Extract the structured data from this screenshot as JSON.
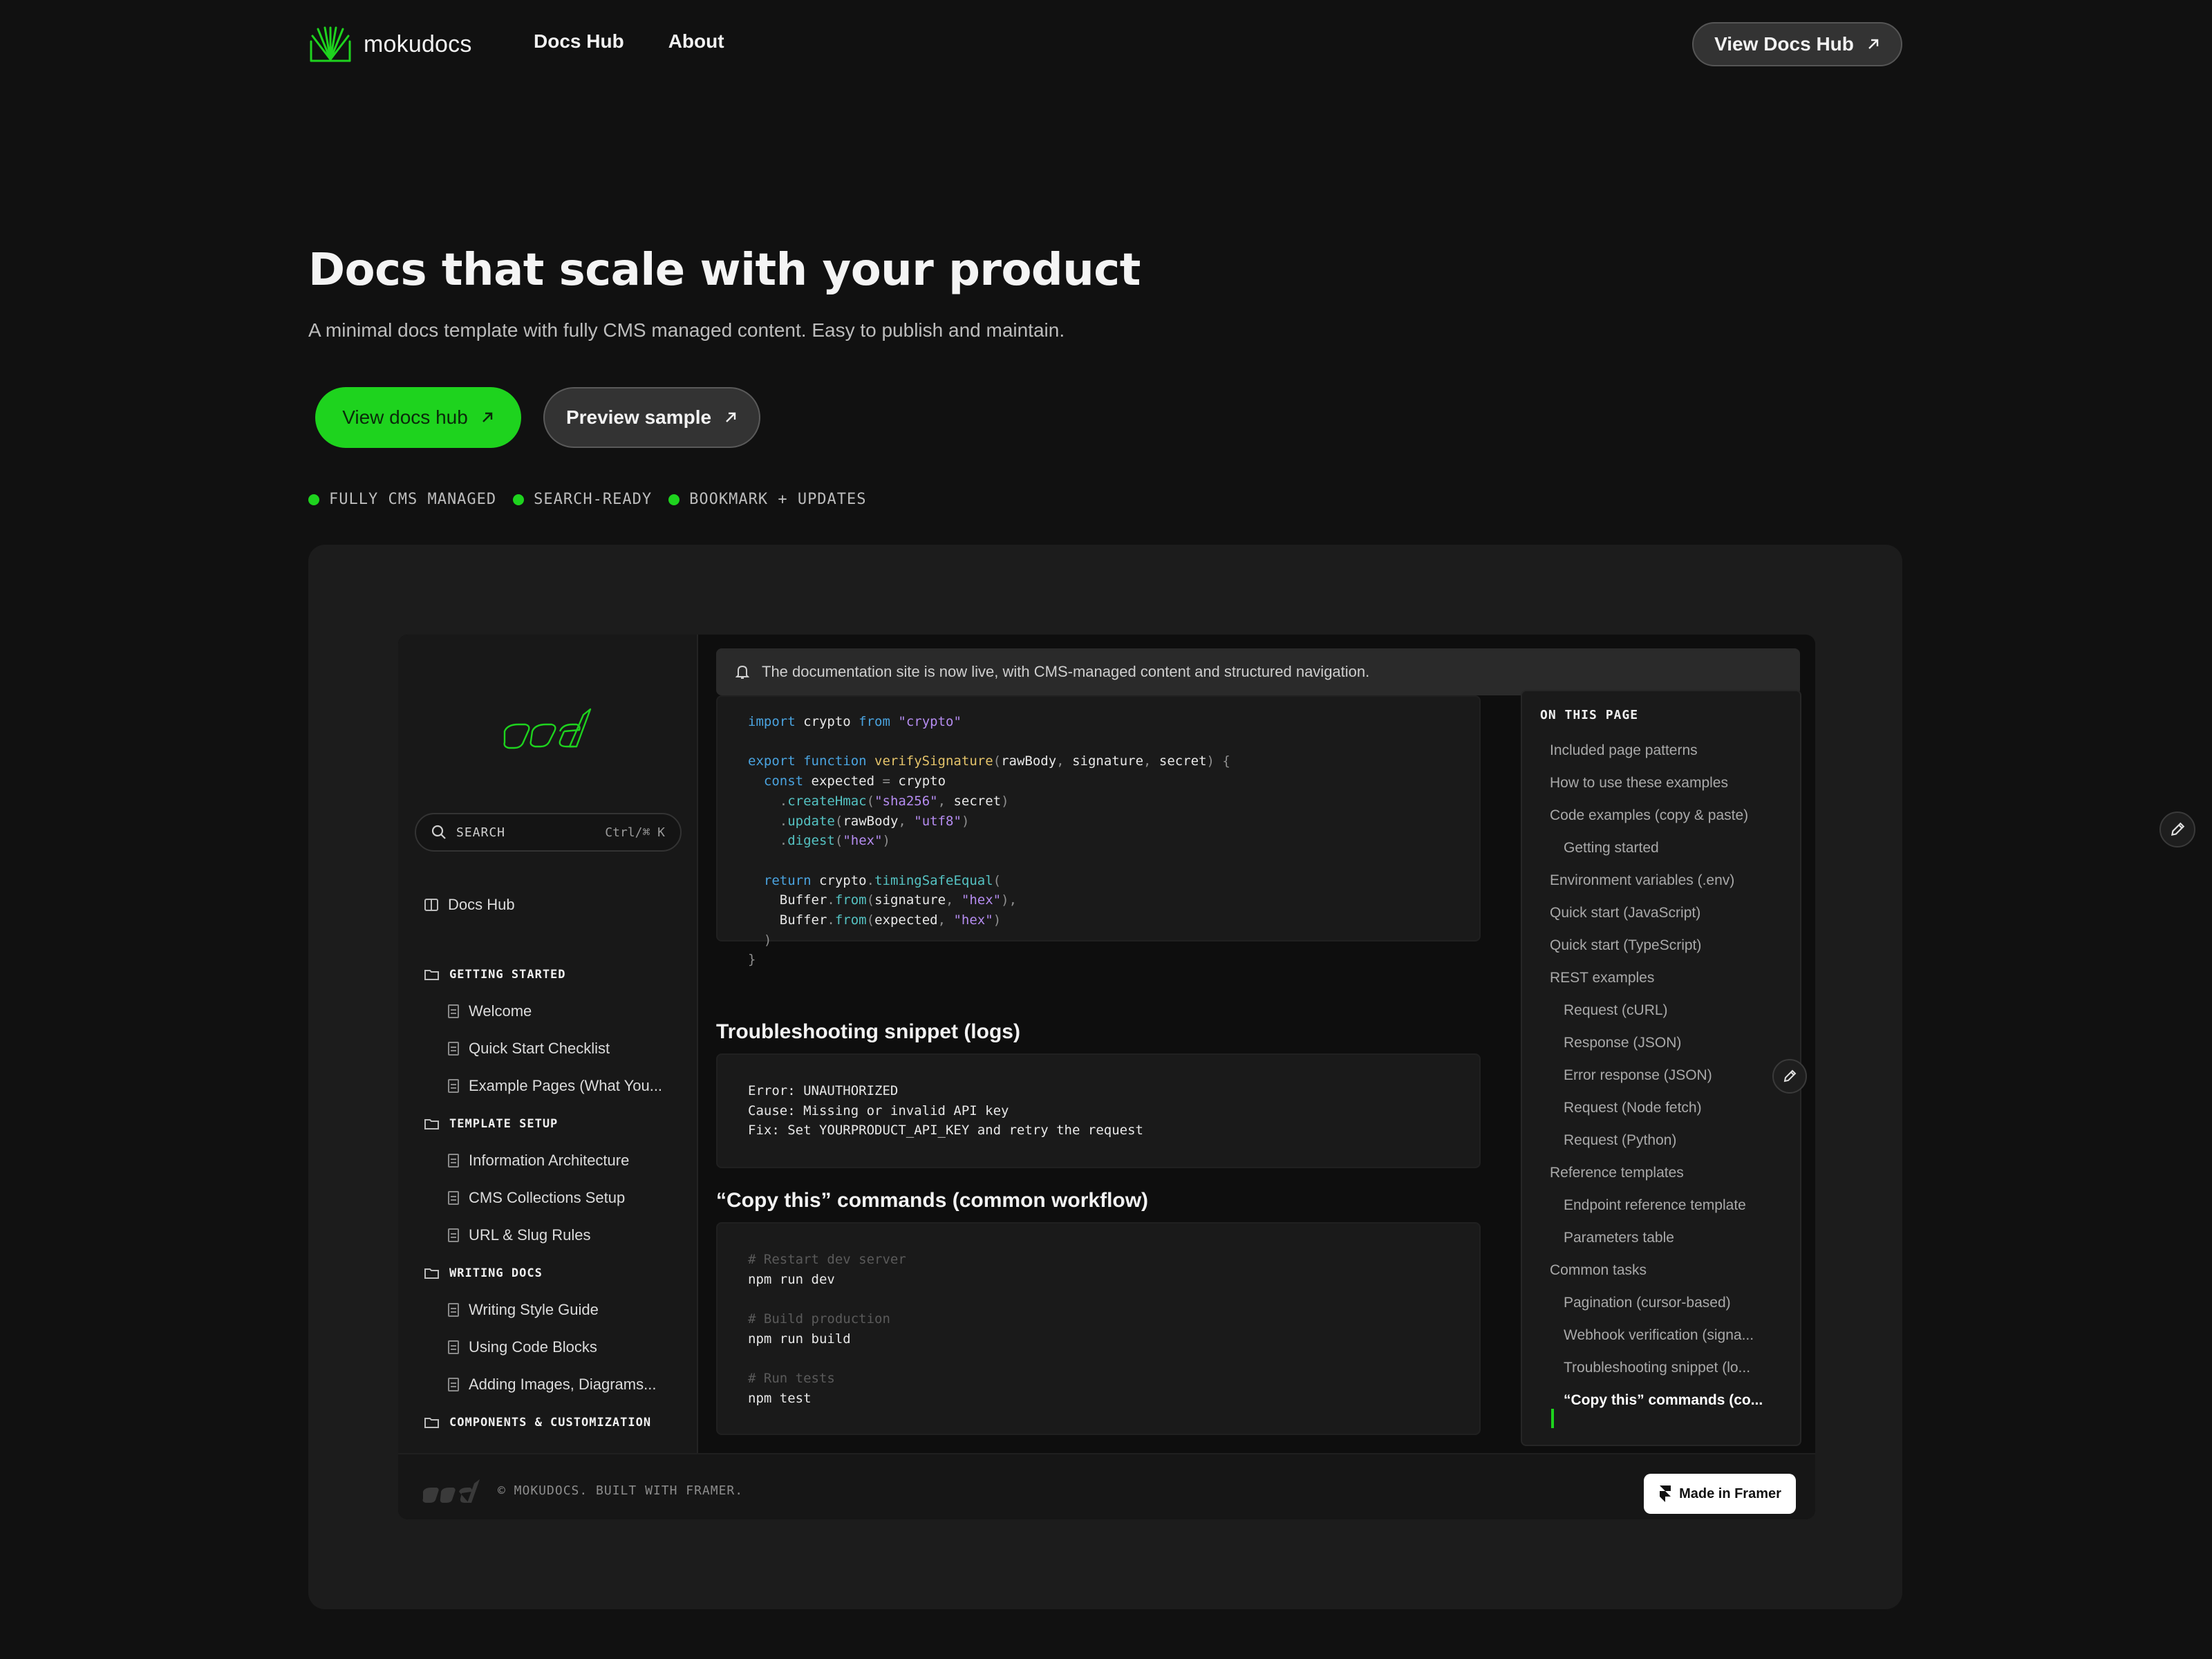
{
  "nav": {
    "brand": "mokudocs",
    "links": [
      "Docs Hub",
      "About"
    ],
    "cta": "View Docs Hub"
  },
  "hero": {
    "title": "Docs that scale with your product",
    "subtitle": "A minimal docs template with fully CMS managed content. Easy to publish and maintain.",
    "primary_button": "View docs hub",
    "secondary_button": "Preview sample",
    "features": [
      "FULLY CMS MANAGED",
      "SEARCH-READY",
      "BOOKMARK + UPDATES"
    ]
  },
  "preview": {
    "search_placeholder": "SEARCH",
    "search_shortcut": "Ctrl/⌘ K",
    "docs_hub_label": "Docs Hub",
    "sections": [
      {
        "title": "GETTING STARTED",
        "items": [
          "Welcome",
          "Quick Start Checklist",
          "Example Pages (What You..."
        ]
      },
      {
        "title": "TEMPLATE SETUP",
        "items": [
          "Information Architecture",
          "CMS Collections Setup",
          "URL & Slug Rules"
        ]
      },
      {
        "title": "WRITING DOCS",
        "items": [
          "Writing Style Guide",
          "Using Code Blocks",
          "Adding Images, Diagrams..."
        ]
      },
      {
        "title": "COMPONENTS & CUSTOMIZATION",
        "items": []
      }
    ],
    "announcement": "The documentation site is now live, with CMS-managed content and structured navigation.",
    "heading_logs": "Troubleshooting snippet (logs)",
    "logs_lines": [
      "Error: UNAUTHORIZED",
      "Cause: Missing or invalid API key",
      "Fix: Set YOURPRODUCT_API_KEY and retry the request"
    ],
    "heading_copy": "“Copy this” commands (common workflow)",
    "commands": [
      {
        "comment": "# Restart dev server",
        "cmd": "npm run dev"
      },
      {
        "comment": "# Build production",
        "cmd": "npm run build"
      },
      {
        "comment": "# Run tests",
        "cmd": "npm test"
      }
    ],
    "toc_title": "ON THIS PAGE",
    "toc_items": [
      "Included page patterns",
      "How to use these examples",
      "Code examples (copy & paste)",
      "Getting started",
      "Environment variables (.env)",
      "Quick start (JavaScript)",
      "Quick start (TypeScript)",
      "REST examples",
      "Request (cURL)",
      "Response (JSON)",
      "Error response (JSON)",
      "Request (Node fetch)",
      "Request (Python)",
      "Reference templates",
      "Endpoint reference template",
      "Parameters table",
      "Common tasks",
      "Pagination (cursor-based)",
      "Webhook verification (signa...",
      "Troubleshooting snippet (lo...",
      "“Copy this” commands (co..."
    ],
    "footer_text": "© MOKUDOCS. BUILT WITH FRAMER.",
    "framer_badge": "Made in Framer"
  },
  "colors": {
    "accent": "#1ed31e",
    "background": "#111111",
    "card": "#1c1c1c"
  }
}
